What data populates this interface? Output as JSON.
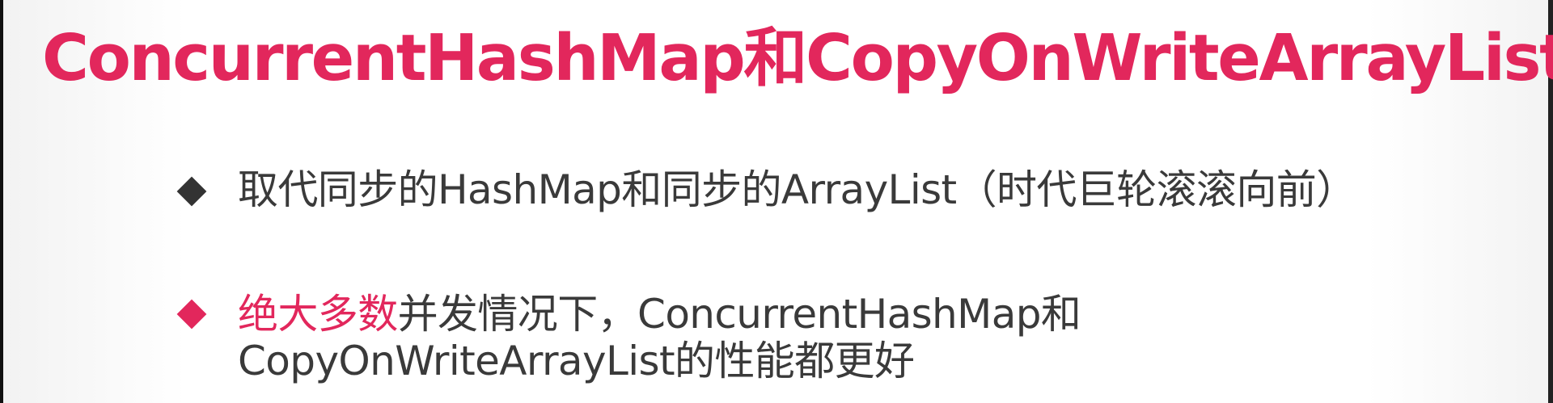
{
  "title": "ConcurrentHashMap和CopyOnWriteArrayList",
  "bullets": [
    {
      "text": "取代同步的HashMap和同步的ArrayList（时代巨轮滚滚向前）"
    },
    {
      "highlight": "绝大多数",
      "rest_line1": "并发情况下，ConcurrentHashMap和",
      "line2": "CopyOnWriteArrayList的性能都更好"
    }
  ],
  "colors": {
    "accent": "#e2275c",
    "text": "#3a3a3a",
    "background": "#ffffff"
  }
}
